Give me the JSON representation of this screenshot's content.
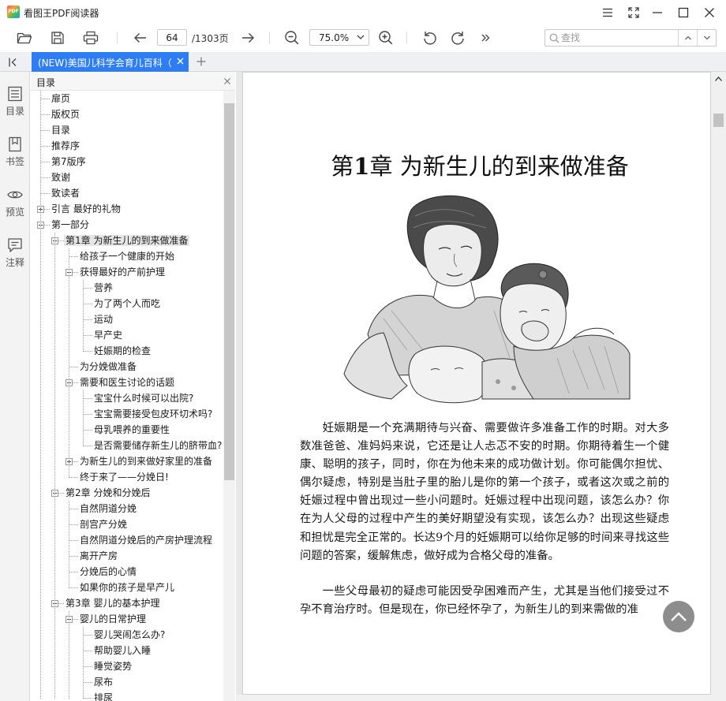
{
  "app": {
    "logo_text": "PDF",
    "title": "看图王PDF阅读器"
  },
  "toolbar": {
    "current_page": "64",
    "total_pages": "/1303页",
    "zoom": "75.0%",
    "search_placeholder": "查找"
  },
  "tabs": [
    {
      "label": "(NEW)美国儿科学会育儿百科（",
      "active": true
    }
  ],
  "rail": {
    "items": [
      {
        "label": "目录",
        "icon": "outline-icon"
      },
      {
        "label": "书签",
        "icon": "bookmark-icon"
      },
      {
        "label": "预览",
        "icon": "eye-icon"
      },
      {
        "label": "注释",
        "icon": "comment-icon"
      }
    ]
  },
  "outline": {
    "title": "目录",
    "items": [
      {
        "label": "扉页",
        "level": 0
      },
      {
        "label": "版权页",
        "level": 0
      },
      {
        "label": "目录",
        "level": 0
      },
      {
        "label": "推荐序",
        "level": 0
      },
      {
        "label": "第7版序",
        "level": 0
      },
      {
        "label": "致谢",
        "level": 0
      },
      {
        "label": "致读者",
        "level": 0
      },
      {
        "label": "引言  最好的礼物",
        "level": 0,
        "expander": "plus"
      },
      {
        "label": "第一部分",
        "level": 0,
        "expander": "minus"
      },
      {
        "label": "第1章  为新生儿的到来做准备",
        "level": 1,
        "expander": "minus",
        "selected": true
      },
      {
        "label": "给孩子一个健康的开始",
        "level": 2
      },
      {
        "label": "获得最好的产前护理",
        "level": 2,
        "expander": "minus"
      },
      {
        "label": "营养",
        "level": 3
      },
      {
        "label": "为了两个人而吃",
        "level": 3
      },
      {
        "label": "运动",
        "level": 3
      },
      {
        "label": "早产史",
        "level": 3
      },
      {
        "label": "妊娠期的检查",
        "level": 3
      },
      {
        "label": "为分娩做准备",
        "level": 2
      },
      {
        "label": "需要和医生讨论的话题",
        "level": 2,
        "expander": "minus"
      },
      {
        "label": "宝宝什么时候可以出院?",
        "level": 3
      },
      {
        "label": "宝宝需要接受包皮环切术吗?",
        "level": 3
      },
      {
        "label": "母乳喂养的重要性",
        "level": 3
      },
      {
        "label": "是否需要储存新生儿的脐带血?",
        "level": 3
      },
      {
        "label": "为新生儿的到来做好家里的准备",
        "level": 2,
        "expander": "plus"
      },
      {
        "label": "终于来了——分娩日!",
        "level": 2
      },
      {
        "label": "第2章  分娩和分娩后",
        "level": 1,
        "expander": "minus"
      },
      {
        "label": "自然阴道分娩",
        "level": 2
      },
      {
        "label": "剖宫产分娩",
        "level": 2
      },
      {
        "label": "自然阴道分娩后的产房护理流程",
        "level": 2
      },
      {
        "label": "离开产房",
        "level": 2
      },
      {
        "label": "分娩后的心情",
        "level": 2
      },
      {
        "label": "如果你的孩子是早产儿",
        "level": 2
      },
      {
        "label": "第3章  婴儿的基本护理",
        "level": 1,
        "expander": "minus"
      },
      {
        "label": "婴儿的日常护理",
        "level": 2,
        "expander": "minus"
      },
      {
        "label": "婴儿哭闹怎么办?",
        "level": 3
      },
      {
        "label": "帮助婴儿入睡",
        "level": 3
      },
      {
        "label": "睡觉姿势",
        "level": 3
      },
      {
        "label": "尿布",
        "level": 3
      },
      {
        "label": "排尿",
        "level": 3
      }
    ]
  },
  "document": {
    "chapter_prefix": "第",
    "chapter_number": "1",
    "chapter_suffix": "章    为新生儿的到来做准备",
    "paragraphs": [
      "妊娠期是一个充满期待与兴奋、需要做许多准备工作的时期。对大多数准爸爸、准妈妈来说，它还是让人忐忑不安的时期。你期待着生一个健康、聪明的孩子，同时，你在为他未来的成功做计划。你可能偶尔担忧、偶尔疑虑，特别是当肚子里的胎儿是你的第一个孩子，或者这次或之前的妊娠过程中曾出现过一些小问题时。妊娠过程中出现问题，该怎么办？你在为人父母的过程中产生的美好期望没有实现，该怎么办？出现这些疑虑和担忧是完全正常的。长达9个月的妊娠期可以给你足够的时间来寻找这些问题的答案，缓解焦虑，做好成为合格父母的准备。",
      "一些父母最初的疑虑可能因受孕困难而产生，尤其是当他们接受过不孕不育治疗时。但是现在，你已经怀孕了，为新生儿的到来需做的准"
    ]
  },
  "colors": {
    "accent": "#2e7df5",
    "rail_bg": "#f3f3f3",
    "view_bg": "#e8e8e8"
  }
}
